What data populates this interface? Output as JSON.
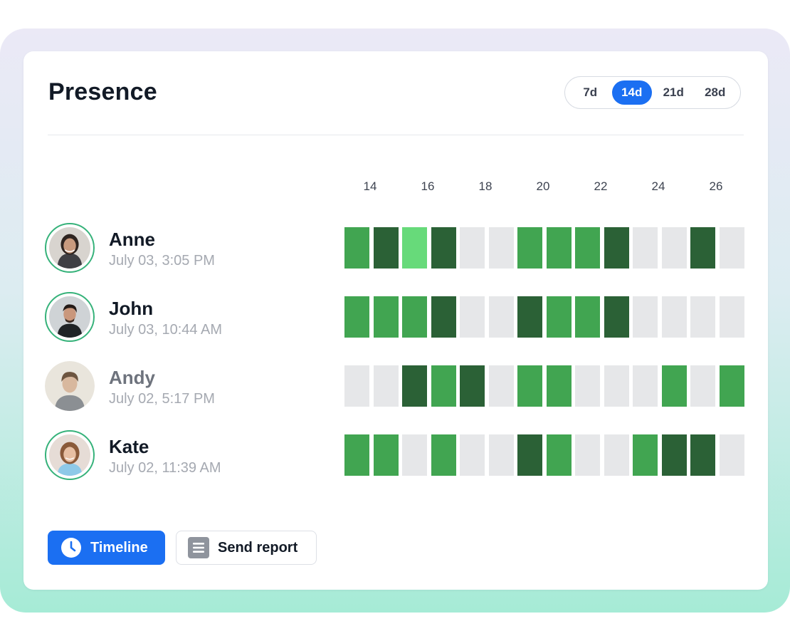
{
  "header": {
    "title": "Presence",
    "ranges": [
      {
        "label": "7d",
        "active": false
      },
      {
        "label": "14d",
        "active": true
      },
      {
        "label": "21d",
        "active": false
      },
      {
        "label": "28d",
        "active": false
      }
    ]
  },
  "timeline": {
    "tick_labels": [
      "14",
      "16",
      "18",
      "20",
      "22",
      "24",
      "26"
    ],
    "level_colors": {
      "none": "#e6e7e9",
      "low": "#67da7a",
      "medium": "#41a551",
      "high": "#2b6136"
    }
  },
  "people": [
    {
      "name": "Anne",
      "last_seen": "July 03, 3:05 PM",
      "highlighted": true,
      "days": [
        "medium",
        "high",
        "low",
        "high",
        "none",
        "none",
        "medium",
        "medium",
        "medium",
        "high",
        "none",
        "none",
        "high",
        "none"
      ]
    },
    {
      "name": "John",
      "last_seen": "July 03, 10:44 AM",
      "highlighted": true,
      "days": [
        "medium",
        "medium",
        "medium",
        "high",
        "none",
        "none",
        "high",
        "medium",
        "medium",
        "high",
        "none",
        "none",
        "none",
        "none"
      ]
    },
    {
      "name": "Andy",
      "last_seen": "July 02, 5:17 PM",
      "highlighted": false,
      "days": [
        "none",
        "none",
        "high",
        "medium",
        "high",
        "none",
        "medium",
        "medium",
        "none",
        "none",
        "none",
        "medium",
        "none",
        "medium"
      ]
    },
    {
      "name": "Kate",
      "last_seen": "July 02, 11:39 AM",
      "highlighted": true,
      "days": [
        "medium",
        "medium",
        "none",
        "medium",
        "none",
        "none",
        "high",
        "medium",
        "none",
        "none",
        "medium",
        "high",
        "high",
        "none"
      ]
    }
  ],
  "actions": {
    "timeline_label": "Timeline",
    "timeline_icon": "clock-icon",
    "report_label": "Send report",
    "report_icon": "document-icon"
  }
}
